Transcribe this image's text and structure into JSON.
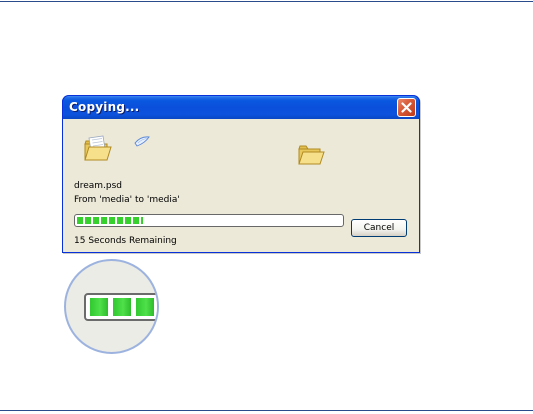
{
  "dialog": {
    "title": "Copying...",
    "filename": "dream.psd",
    "from_to": "From 'media' to 'media'",
    "time_remaining": "15 Seconds Remaining",
    "cancel_label": "Cancel",
    "progress_fraction": 0.25,
    "icons": [
      "folder-icon",
      "flying-paper-icon",
      "folder-icon",
      "close-icon"
    ]
  },
  "magnifier": {
    "icon": "magnified-progress-bar"
  },
  "colors": {
    "titlebar": "#0a4fdb",
    "dialog_bg": "#ece9d8",
    "progress_green": "#37d12e",
    "close_button": "#d95d3a",
    "rule": "#2b4c8c"
  }
}
